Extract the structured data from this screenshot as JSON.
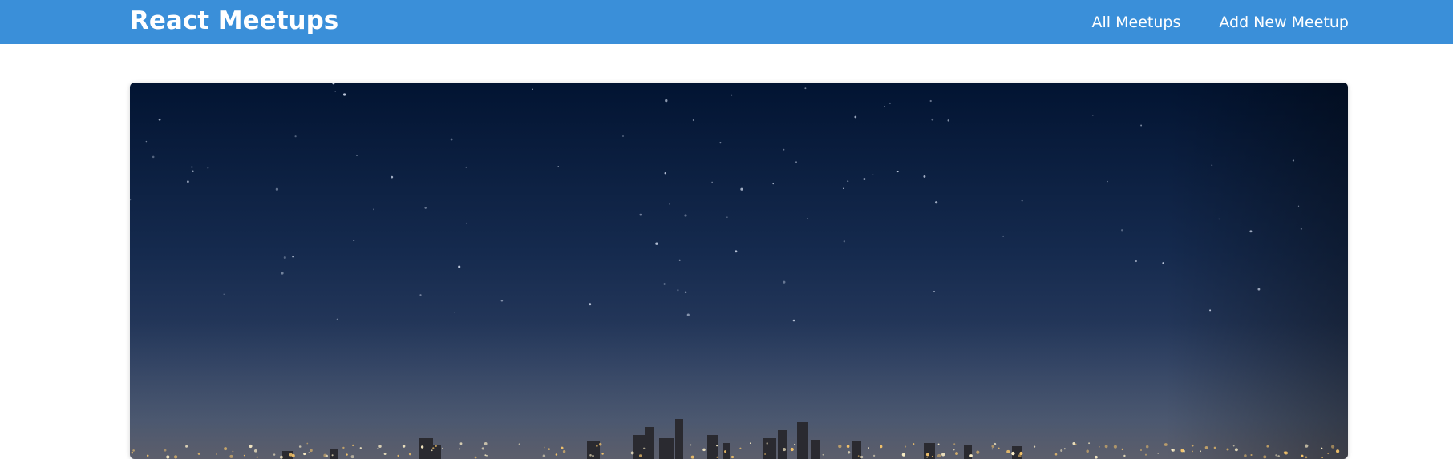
{
  "header": {
    "logo": "React Meetups",
    "nav": [
      {
        "label": "All Meetups"
      },
      {
        "label": "Add New Meetup"
      }
    ]
  },
  "colors": {
    "header_bg": "#3a8fd9",
    "text_on_header": "#ffffff",
    "sky_top": "#021432",
    "sky_bottom": "#2d3f5e"
  },
  "main": {
    "card": {
      "image": "night-city-skyline-photo"
    }
  }
}
